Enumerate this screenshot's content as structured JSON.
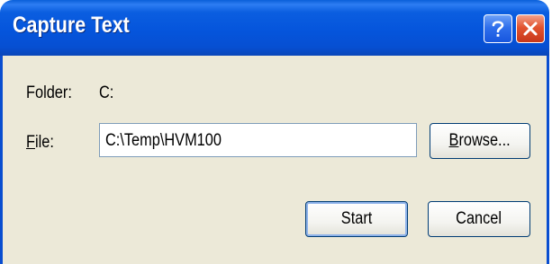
{
  "window": {
    "title": "Capture Text",
    "help_icon": "help-question-icon",
    "close_icon": "close-x-icon"
  },
  "folder": {
    "label": "Folder:",
    "value": "C:"
  },
  "file": {
    "label_underlined": "F",
    "label_rest": "ile:",
    "value": "C:\\Temp\\HVM100"
  },
  "buttons": {
    "browse_underlined": "B",
    "browse_rest": "rowse...",
    "start": "Start",
    "cancel": "Cancel"
  },
  "colors": {
    "titlebar": "#0555dc",
    "client_bg": "#ece9d8",
    "close_button": "#e2542f",
    "help_button": "#2f6fec"
  }
}
